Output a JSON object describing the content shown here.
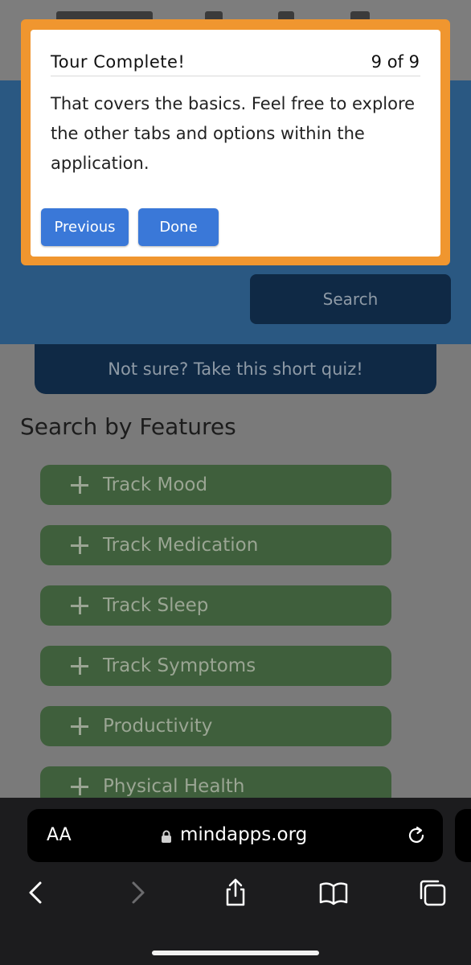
{
  "tour": {
    "title": "Tour Complete!",
    "count": "9 of 9",
    "body": "That covers the basics. Feel free to explore the other tabs and options within the application.",
    "previous_label": "Previous",
    "done_label": "Done"
  },
  "main": {
    "search_label": "Search",
    "quiz_label": "Not sure? Take this short quiz!",
    "section_title": "Search by Features",
    "features": [
      {
        "label": "Track Mood"
      },
      {
        "label": "Track Medication"
      },
      {
        "label": "Track Sleep"
      },
      {
        "label": "Track Symptoms"
      },
      {
        "label": "Productivity"
      },
      {
        "label": "Physical Health"
      }
    ]
  },
  "browser": {
    "text_size_label": "AA",
    "url": "mindapps.org",
    "icons": [
      "back-icon",
      "forward-icon",
      "share-icon",
      "bookmarks-icon",
      "tabs-icon",
      "lock-icon",
      "reload-icon"
    ]
  },
  "colors": {
    "tour_border": "#f0962f",
    "tour_button": "#3a78d8",
    "header_blue": "#2a5882",
    "dark_button": "#0f2945",
    "feature_green": "#3f5f3c"
  }
}
